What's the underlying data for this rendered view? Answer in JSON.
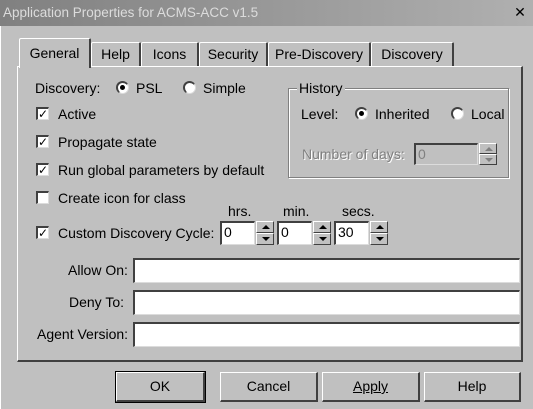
{
  "window": {
    "title": "Application Properties for ACMS-ACC  v1.5"
  },
  "tabs": [
    {
      "label": "General",
      "active": true
    },
    {
      "label": "Help",
      "active": false
    },
    {
      "label": "Icons",
      "active": false
    },
    {
      "label": "Security",
      "active": false
    },
    {
      "label": "Pre-Discovery",
      "active": false
    },
    {
      "label": "Discovery",
      "active": false
    }
  ],
  "general": {
    "discovery": {
      "label": "Discovery:",
      "options": [
        {
          "label": "PSL",
          "selected": true
        },
        {
          "label": "Simple",
          "selected": false
        }
      ]
    },
    "checkboxes": [
      {
        "label": "Active",
        "checked": true
      },
      {
        "label": "Propagate state",
        "checked": true
      },
      {
        "label": "Run global parameters by default",
        "checked": true
      },
      {
        "label": "Create icon for class",
        "checked": false
      }
    ],
    "history": {
      "title": "History",
      "level_label": "Level:",
      "options": [
        {
          "label": "Inherited",
          "selected": true
        },
        {
          "label": "Local",
          "selected": false
        }
      ],
      "days_label": "Number of days:",
      "days_value": "0"
    },
    "cycle": {
      "label": "Custom Discovery Cycle:",
      "checked": true,
      "hrs_label": "hrs.",
      "hrs_value": "0",
      "min_label": "min.",
      "min_value": "0",
      "secs_label": "secs.",
      "secs_value": "30"
    },
    "allow_on": {
      "label": "Allow On:",
      "value": ""
    },
    "deny_to": {
      "label": "Deny To:",
      "value": ""
    },
    "agent_version": {
      "label": "Agent Version:",
      "value": ""
    }
  },
  "buttons": {
    "ok": "OK",
    "cancel": "Cancel",
    "apply": "Apply",
    "help": "Help"
  },
  "colors": {
    "face": "#c0c0c0",
    "shadow": "#404040",
    "highlight": "#ffffff",
    "title_bar": "#808080"
  }
}
